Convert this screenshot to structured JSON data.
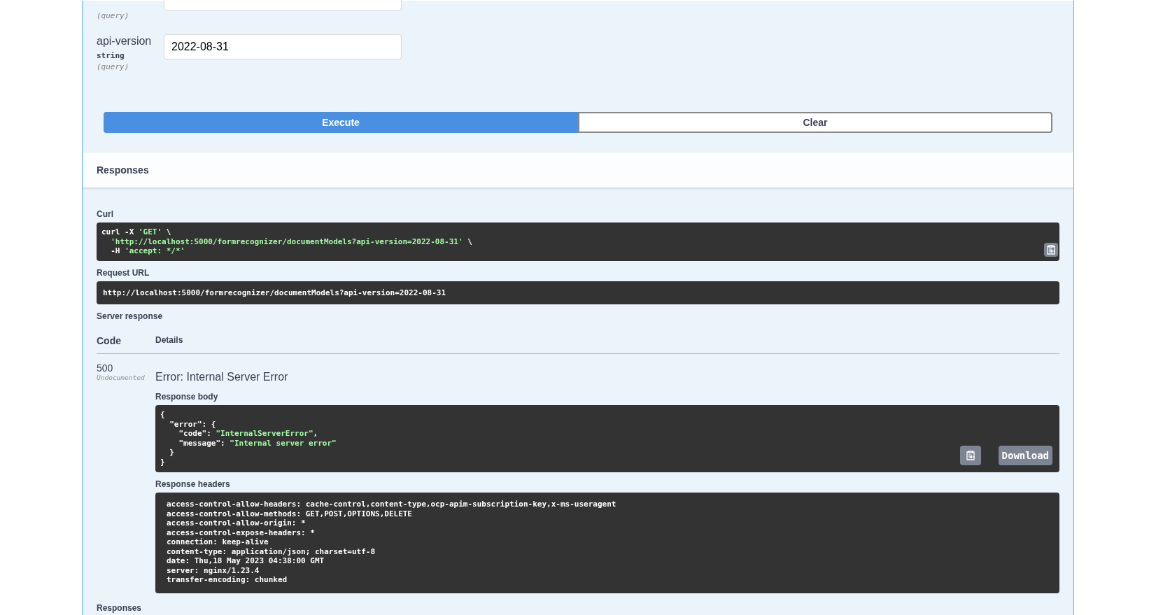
{
  "parameters": [
    {
      "location": "(query)"
    },
    {
      "name": "api-version",
      "type": "string",
      "location": "(query)",
      "value": "2022-08-31"
    }
  ],
  "buttons": [
    {
      "label": "Execute",
      "kind": "primary"
    },
    {
      "label": "Clear",
      "kind": "secondary"
    }
  ],
  "responses_title": "Responses",
  "curl": {
    "label": "Curl",
    "lines": [
      [
        {
          "text": "curl -X ",
          "kind": "plain"
        },
        {
          "text": "'GET'",
          "kind": "string"
        },
        {
          "text": " \\",
          "kind": "plain"
        }
      ],
      [
        {
          "text": "  'http://localhost:5000/formrecognizer/documentModels?api-version=2022-08-31'",
          "kind": "string"
        },
        {
          "text": " \\",
          "kind": "plain"
        }
      ],
      [
        {
          "text": "  -H ",
          "kind": "plain"
        },
        {
          "text": "'accept: */*'",
          "kind": "string"
        }
      ]
    ]
  },
  "request_url": {
    "label": "Request URL",
    "value": "http://localhost:5000/formrecognizer/documentModels?api-version=2022-08-31"
  },
  "server_response": {
    "label": "Server response",
    "columns": [
      "Code",
      "Details"
    ],
    "row": {
      "code": "500",
      "note": "Undocumented",
      "title": "Error: Internal Server Error",
      "body_label": "Response body",
      "body_lines": [
        [
          {
            "text": "{",
            "kind": "plain"
          }
        ],
        [
          {
            "text": "  \"error\": {",
            "kind": "plain"
          }
        ],
        [
          {
            "text": "    \"code\": ",
            "kind": "plain"
          },
          {
            "text": "\"InternalServerError\"",
            "kind": "string"
          },
          {
            "text": ",",
            "kind": "plain"
          }
        ],
        [
          {
            "text": "    \"message\": ",
            "kind": "plain"
          },
          {
            "text": "\"Internal server error\"",
            "kind": "string"
          }
        ],
        [
          {
            "text": "  }",
            "kind": "plain"
          }
        ],
        [
          {
            "text": "}",
            "kind": "plain"
          }
        ]
      ],
      "download": "Download",
      "headers_label": "Response headers",
      "headers": [
        "access-control-allow-headers: cache-control,content-type,ocp-apim-subscription-key,x-ms-useragent",
        "access-control-allow-methods: GET,POST,OPTIONS,DELETE",
        "access-control-allow-origin: *",
        "access-control-expose-headers: *",
        "connection: keep-alive",
        "content-type: application/json; charset=utf-8",
        "date: Thu,18 May 2023 04:38:00 GMT",
        "server: nginx/1.23.4",
        "transfer-encoding: chunked"
      ]
    }
  },
  "footer_title": "Responses"
}
